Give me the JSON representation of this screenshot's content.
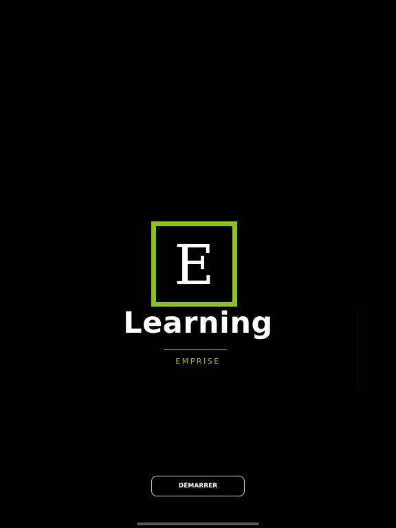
{
  "logo": {
    "letter": "E",
    "title": "Learning",
    "subtitle": "EMPRISE"
  },
  "actions": {
    "start_label": "DÉMARRER"
  },
  "colors": {
    "background": "#000000",
    "accent": "#8dc21f",
    "text": "#ffffff"
  }
}
